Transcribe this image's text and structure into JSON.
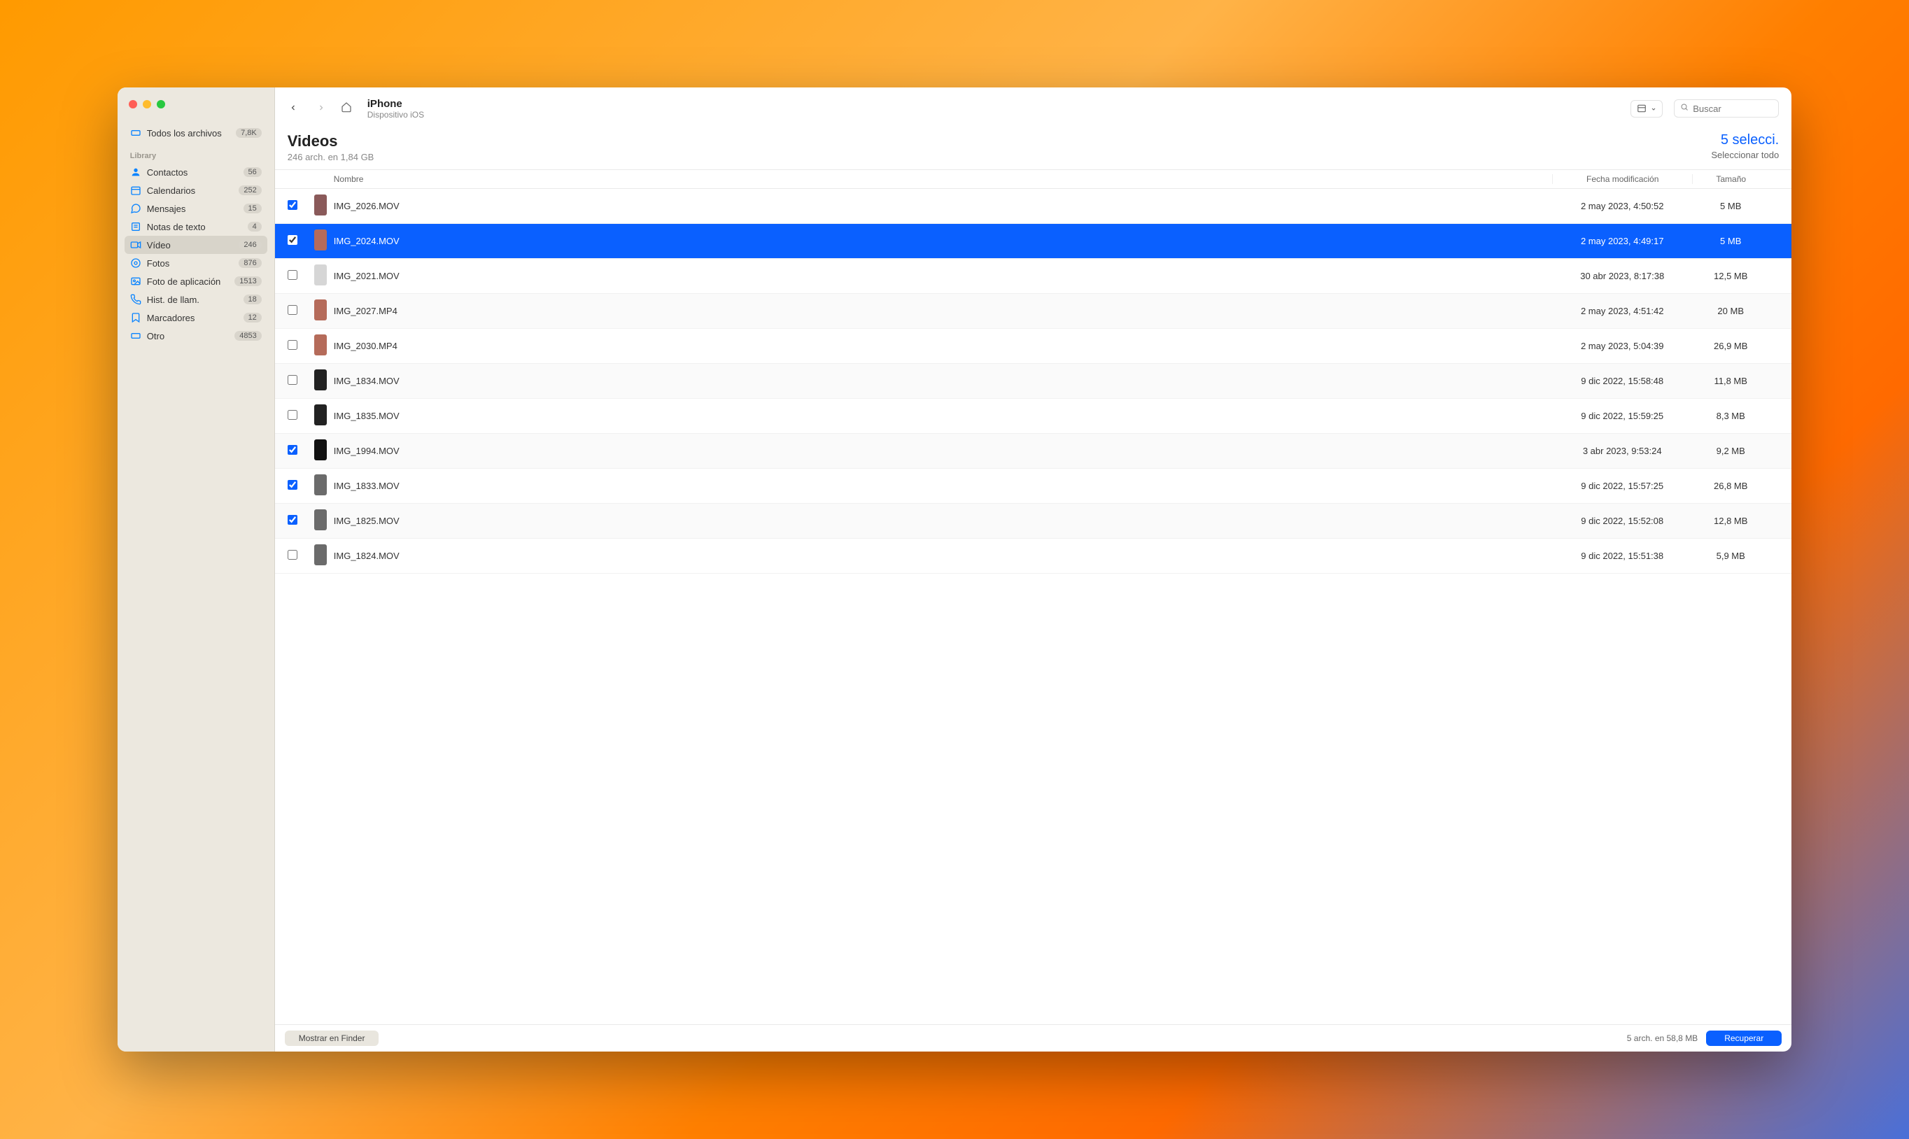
{
  "sidebar": {
    "all_files": {
      "label": "Todos los archivos",
      "count": "7,8K"
    },
    "section_label": "Library",
    "items": [
      {
        "label": "Contactos",
        "count": "56",
        "icon": "contact-icon",
        "color": "#0a84ff"
      },
      {
        "label": "Calendarios",
        "count": "252",
        "icon": "calendar-icon",
        "color": "#0a84ff"
      },
      {
        "label": "Mensajes",
        "count": "15",
        "icon": "message-icon",
        "color": "#0a84ff"
      },
      {
        "label": "Notas de texto",
        "count": "4",
        "icon": "note-icon",
        "color": "#0a84ff"
      },
      {
        "label": "Vídeo",
        "count": "246",
        "icon": "video-icon",
        "color": "#0a84ff"
      },
      {
        "label": "Fotos",
        "count": "876",
        "icon": "photo-icon",
        "color": "#0a84ff"
      },
      {
        "label": "Foto de aplicación",
        "count": "1513",
        "icon": "app-photo-icon",
        "color": "#0a84ff"
      },
      {
        "label": "Hist. de llam.",
        "count": "18",
        "icon": "phone-icon",
        "color": "#0a84ff"
      },
      {
        "label": "Marcadores",
        "count": "12",
        "icon": "bookmark-icon",
        "color": "#0a84ff"
      },
      {
        "label": "Otro",
        "count": "4853",
        "icon": "other-icon",
        "color": "#0a84ff"
      }
    ]
  },
  "toolbar": {
    "crumb_title": "iPhone",
    "crumb_sub": "Dispositivo iOS",
    "search_placeholder": "Buscar"
  },
  "heading": {
    "title": "Videos",
    "subtitle": "246 arch. en 1,84 GB",
    "selection_count": "5 selecci.",
    "select_all": "Seleccionar todo"
  },
  "columns": {
    "name": "Nombre",
    "date": "Fecha modificación",
    "size": "Tamaño"
  },
  "rows": [
    {
      "name": "IMG_2026.MOV",
      "date": "2 may 2023, 4:50:52",
      "size": "5 MB",
      "checked": true,
      "selected": false,
      "thumb": "#8a5a5a"
    },
    {
      "name": "IMG_2024.MOV",
      "date": "2 may 2023, 4:49:17",
      "size": "5 MB",
      "checked": true,
      "selected": true,
      "thumb": "#b56b5a"
    },
    {
      "name": "IMG_2021.MOV",
      "date": "30 abr 2023, 8:17:38",
      "size": "12,5 MB",
      "checked": false,
      "selected": false,
      "thumb": "#d6d6d6"
    },
    {
      "name": "IMG_2027.MP4",
      "date": "2 may 2023, 4:51:42",
      "size": "20 MB",
      "checked": false,
      "selected": false,
      "thumb": "#b56b5a"
    },
    {
      "name": "IMG_2030.MP4",
      "date": "2 may 2023, 5:04:39",
      "size": "26,9 MB",
      "checked": false,
      "selected": false,
      "thumb": "#b56b5a"
    },
    {
      "name": "IMG_1834.MOV",
      "date": "9 dic 2022, 15:58:48",
      "size": "11,8 MB",
      "checked": false,
      "selected": false,
      "thumb": "#222"
    },
    {
      "name": "IMG_1835.MOV",
      "date": "9 dic 2022, 15:59:25",
      "size": "8,3 MB",
      "checked": false,
      "selected": false,
      "thumb": "#222"
    },
    {
      "name": "IMG_1994.MOV",
      "date": "3 abr 2023, 9:53:24",
      "size": "9,2 MB",
      "checked": true,
      "selected": false,
      "thumb": "#111"
    },
    {
      "name": "IMG_1833.MOV",
      "date": "9 dic 2022, 15:57:25",
      "size": "26,8 MB",
      "checked": true,
      "selected": false,
      "thumb": "#6b6b6b"
    },
    {
      "name": "IMG_1825.MOV",
      "date": "9 dic 2022, 15:52:08",
      "size": "12,8 MB",
      "checked": true,
      "selected": false,
      "thumb": "#6b6b6b"
    },
    {
      "name": "IMG_1824.MOV",
      "date": "9 dic 2022, 15:51:38",
      "size": "5,9 MB",
      "checked": false,
      "selected": false,
      "thumb": "#6b6b6b"
    }
  ],
  "footer": {
    "show_in_finder": "Mostrar en Finder",
    "status": "5 arch. en 58,8 MB",
    "recover": "Recuperar"
  }
}
